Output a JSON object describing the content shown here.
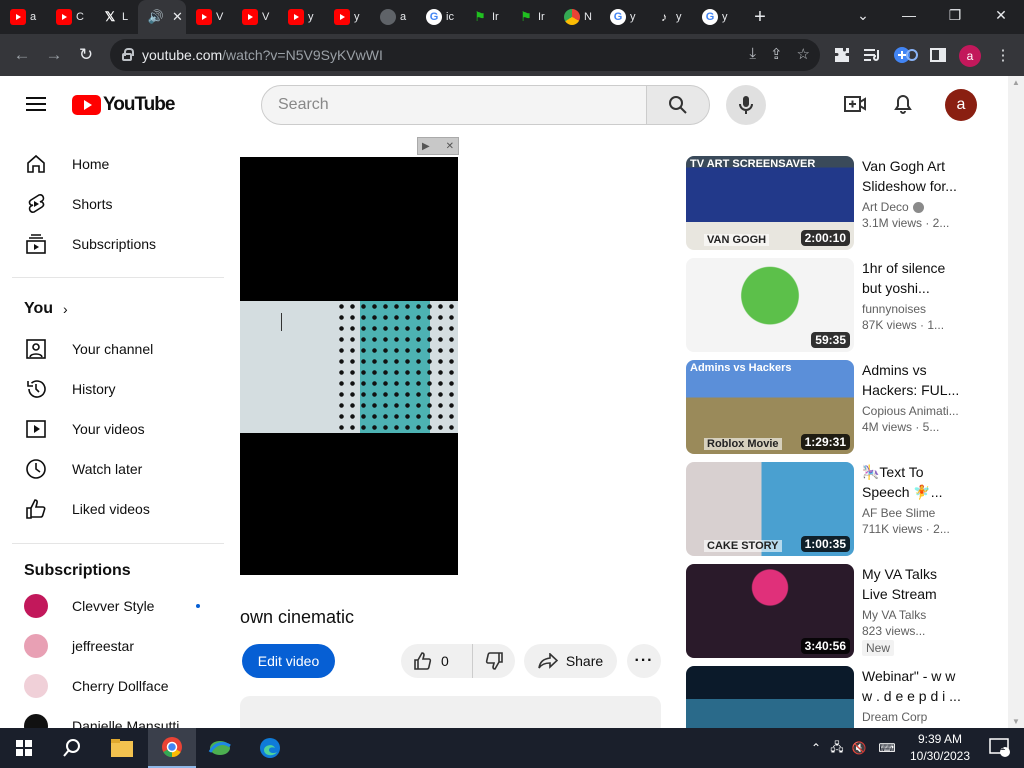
{
  "browser": {
    "tabs": [
      {
        "icon": "youtube-icon",
        "label": "a"
      },
      {
        "icon": "youtube-icon",
        "label": "C"
      },
      {
        "icon": "x-icon",
        "label": "L"
      },
      {
        "icon": "speaker-icon",
        "label": "",
        "active": true
      },
      {
        "icon": "youtube-icon",
        "label": "V"
      },
      {
        "icon": "youtube-icon",
        "label": "V"
      },
      {
        "icon": "youtube-icon",
        "label": "y"
      },
      {
        "icon": "youtube-icon",
        "label": "y"
      },
      {
        "icon": "globe-icon",
        "label": "a"
      },
      {
        "icon": "google-icon",
        "label": "ic"
      },
      {
        "icon": "flag-icon",
        "label": "Ir"
      },
      {
        "icon": "flag-icon",
        "label": "Ir"
      },
      {
        "icon": "chrome-icon",
        "label": "N"
      },
      {
        "icon": "google-icon",
        "label": "y"
      },
      {
        "icon": "tiktok-icon",
        "label": "y"
      },
      {
        "icon": "google-icon",
        "label": "y"
      }
    ],
    "url_host": "youtube.com",
    "url_path": "/watch?v=N5V9SyKVwWI",
    "profile_initial": "a"
  },
  "youtube": {
    "logo_text": "YouTube",
    "search_placeholder": "Search",
    "avatar_initial": "a",
    "nav_main": [
      {
        "label": "Home",
        "icon": "home-icon"
      },
      {
        "label": "Shorts",
        "icon": "shorts-icon"
      },
      {
        "label": "Subscriptions",
        "icon": "subscriptions-icon"
      }
    ],
    "you_section": "You",
    "nav_you": [
      {
        "label": "Your channel",
        "icon": "your-channel-icon"
      },
      {
        "label": "History",
        "icon": "history-icon"
      },
      {
        "label": "Your videos",
        "icon": "your-videos-icon"
      },
      {
        "label": "Watch later",
        "icon": "watch-later-icon"
      },
      {
        "label": "Liked videos",
        "icon": "liked-videos-icon"
      }
    ],
    "subscriptions_title": "Subscriptions",
    "subscriptions": [
      {
        "name": "Clevver Style",
        "color": "#c2185b",
        "new": true
      },
      {
        "name": "jeffreestar",
        "color": "#e8a0b4",
        "new": false
      },
      {
        "name": "Cherry Dollface",
        "color": "#f0d0d8",
        "new": false
      },
      {
        "name": "Danielle Mansutti",
        "color": "#111111",
        "new": false
      }
    ],
    "video": {
      "title_fragment": "own cinematic",
      "edit_label": "Edit video",
      "like_count": "0",
      "share_label": "Share"
    },
    "recommendations": [
      {
        "title": "Van Gogh Art Slideshow for...",
        "channel": "Art Deco",
        "verified": true,
        "meta": "3.1M views · 2...",
        "duration": "2:00:10",
        "thumb_text_top": "TV ART SCREENSAVER",
        "thumb_text_bottom": "VAN GOGH"
      },
      {
        "title": "1hr of silence but yoshi...",
        "channel": "funnynoises",
        "verified": false,
        "meta": "87K views · 1...",
        "duration": "59:35"
      },
      {
        "title": "Admins vs Hackers: FUL...",
        "channel": "Copious Animati...",
        "verified": false,
        "meta": "4M views · 5...",
        "duration": "1:29:31",
        "thumb_text_top": "Admins vs Hackers",
        "thumb_text_bottom": "Roblox Movie"
      },
      {
        "title": "🎠Text To Speech 🧚...",
        "channel": "AF Bee Slime",
        "verified": false,
        "meta": "711K views · 2...",
        "duration": "1:00:35",
        "thumb_text_bottom": "CAKE STORY"
      },
      {
        "title": "My VA Talks Live Stream",
        "channel": "My VA Talks",
        "verified": false,
        "meta": "823 views...",
        "badge": "New",
        "duration": "3:40:56"
      },
      {
        "title": "Webinar\" - w w w . d e e p d i ...",
        "channel": "Dream Corp",
        "verified": false,
        "meta": "",
        "duration": ""
      }
    ]
  },
  "taskbar": {
    "time": "9:39 AM",
    "date": "10/30/2023",
    "notification_count": "1"
  },
  "colors": {
    "brand_red": "#ff0000",
    "accent_blue": "#065fd4",
    "chrome_dark": "#202124"
  }
}
